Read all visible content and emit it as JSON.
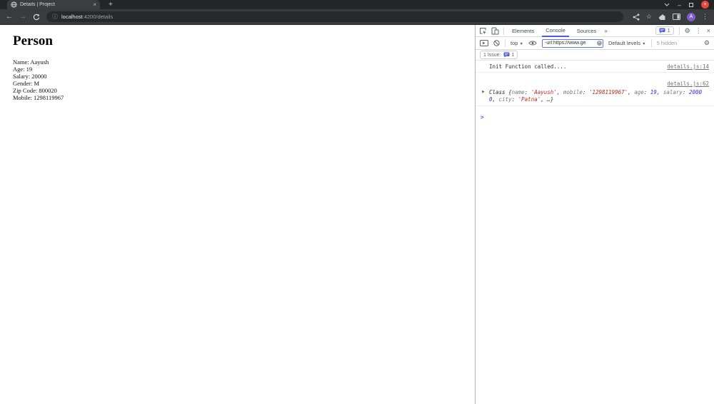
{
  "browser": {
    "tab": {
      "title": "Details | Project"
    },
    "url": {
      "host": "localhost",
      "path": ":4200/details"
    },
    "avatar_letter": "A"
  },
  "icons": {
    "back": "←",
    "forward": "→",
    "info": "ⓘ",
    "star": "☆",
    "kebab": "⋮",
    "new_tab": "+",
    "tab_close": "×",
    "win_min": "–",
    "win_close": "×",
    "more_tabs": "»",
    "gear": "⚙",
    "dt_close": "×",
    "caret": "▼",
    "expand": "▶",
    "prompt": ">",
    "clear_x": "×"
  },
  "page": {
    "heading": "Person",
    "fields": [
      "Name: Aayush",
      "Age: 19",
      "Salary: 20000",
      "Gender: M",
      "Zip Code: 800020",
      "Mobile: 1298119967"
    ]
  },
  "devtools": {
    "tabs": [
      {
        "label": "Elements"
      },
      {
        "label": "Console"
      },
      {
        "label": "Sources"
      }
    ],
    "active_tab": "Console",
    "badge_count": "1",
    "toolbar": {
      "context": "top",
      "filter_value": "-url:https://www.ge",
      "levels_label": "Default levels",
      "hidden_label": "5 hidden"
    },
    "issues": {
      "label": "1 Issue:",
      "count": "1"
    },
    "console": {
      "messages": [
        {
          "text": "Init Function called....",
          "source": "details.js:14"
        },
        {
          "source": "details.js:62"
        }
      ],
      "preview_tokens": [
        {
          "type": "class",
          "text": "Class "
        },
        {
          "type": "punct",
          "text": "{"
        },
        {
          "type": "key",
          "text": "name"
        },
        {
          "type": "punct",
          "text": ": "
        },
        {
          "type": "str",
          "text": "'Aayush'"
        },
        {
          "type": "punct",
          "text": ", "
        },
        {
          "type": "key",
          "text": "mobile"
        },
        {
          "type": "punct",
          "text": ": "
        },
        {
          "type": "str",
          "text": "'1298119967'"
        },
        {
          "type": "punct",
          "text": ", "
        },
        {
          "type": "key",
          "text": "age"
        },
        {
          "type": "punct",
          "text": ": "
        },
        {
          "type": "num",
          "text": "19"
        },
        {
          "type": "punct",
          "text": ", "
        },
        {
          "type": "key",
          "text": "salary"
        },
        {
          "type": "punct",
          "text": ": "
        },
        {
          "type": "num",
          "text": "20000"
        },
        {
          "type": "punct",
          "text": ", "
        },
        {
          "type": "key",
          "text": "city"
        },
        {
          "type": "punct",
          "text": ": "
        },
        {
          "type": "str",
          "text": "'Patna'"
        },
        {
          "type": "punct",
          "text": ", …}"
        }
      ],
      "prompt_symbol": ">"
    }
  }
}
